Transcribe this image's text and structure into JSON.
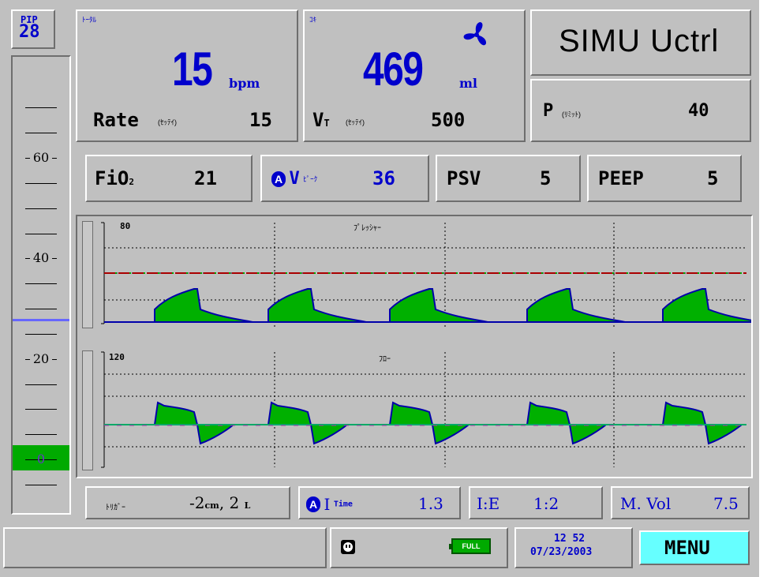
{
  "gauge": {
    "pip_label": "PIP",
    "pip_value": "28",
    "scale_labels": [
      "60",
      "40",
      "20",
      "0"
    ],
    "scale_values": [
      60,
      40,
      20,
      0
    ],
    "marker_value": 28
  },
  "rate_panel": {
    "title": "ﾄｰﾀﾙ",
    "measured": "15",
    "unit": "bpm",
    "set_label": "Rate",
    "set_sub": "(ｾｯﾃｲ)",
    "set_value": "15"
  },
  "vt_panel": {
    "title": "ｺｷ",
    "measured": "469",
    "unit": "ml",
    "set_label": "V",
    "set_label_sub": "T",
    "set_sub": "(ｾｯﾃｲ)",
    "set_value": "500",
    "icon": "fan-icon"
  },
  "mode": {
    "text": "SIMU Uctrl"
  },
  "plimit": {
    "label": "P",
    "sub": "(ﾘﾐｯﾄ)",
    "value": "40"
  },
  "fio2": {
    "label": "FiO",
    "sub": "2",
    "value": "21"
  },
  "peakflow": {
    "badge": "A",
    "label": "V",
    "sub": "ﾋﾟｰｸ",
    "value": "36"
  },
  "psv": {
    "label": "PSV",
    "value": "5"
  },
  "peep": {
    "label": "PEEP",
    "value": "5"
  },
  "pressure_chart": {
    "title": "ﾌﾟﾚｯｼｬｰ",
    "scale_max": "80"
  },
  "flow_chart": {
    "title": "ﾌﾛｰ",
    "scale_max": "120"
  },
  "trigger": {
    "label": "ﾄﾘｶﾞｰ",
    "value": "-2",
    "unit1": "cm",
    "sep": ",",
    "value2": "2",
    "unit2": "L"
  },
  "itime": {
    "badge": "A",
    "label": "I",
    "sub": "Time",
    "value": "1.3"
  },
  "ie": {
    "label": "I:E",
    "value": "1:2"
  },
  "mvol": {
    "label": "M. Vol",
    "value": "7.5"
  },
  "status": {
    "battery": "FULL",
    "time": "12  52",
    "date": "07/23/2003",
    "menu": "MENU"
  },
  "colors": {
    "bg": "#c0c0c0",
    "value_blue": "#0000cc",
    "wave_fill": "#00b000",
    "wave_line": "#0000aa",
    "limit_line": "#aa0000",
    "menu_bg": "#66ffff"
  }
}
